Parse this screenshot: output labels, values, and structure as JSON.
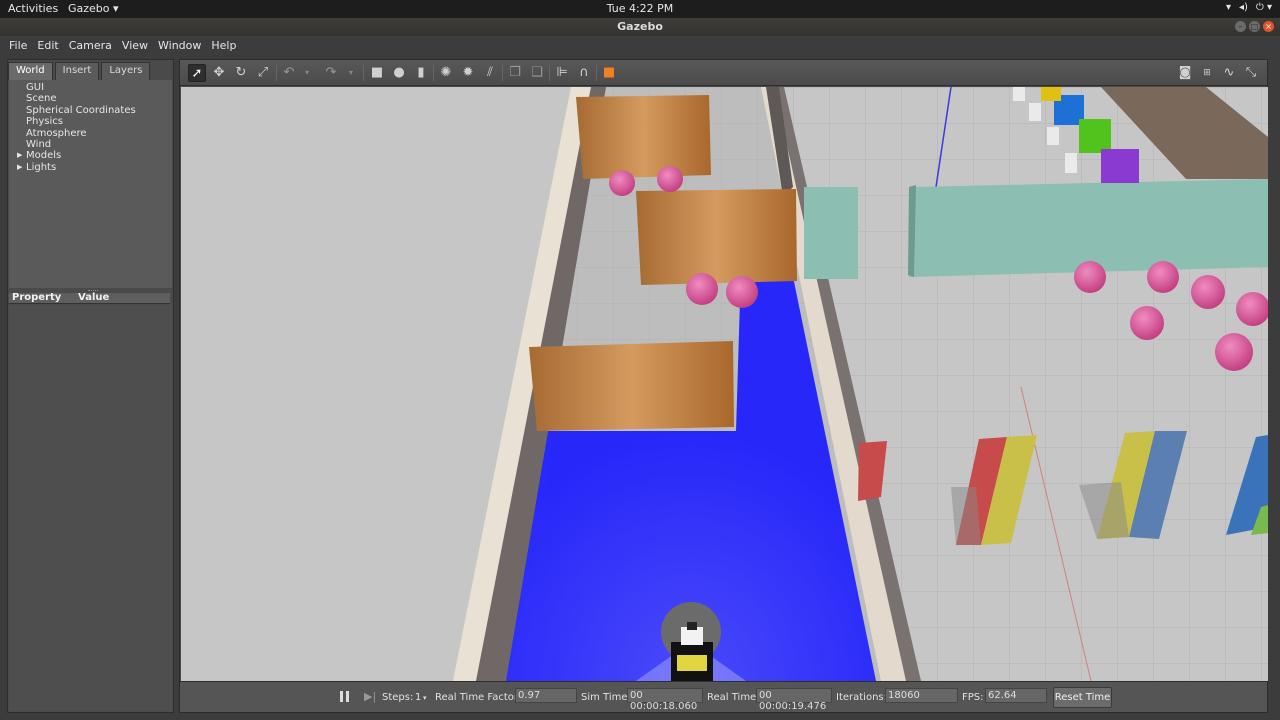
{
  "topbar": {
    "activities": "Activities",
    "app_menu": "Gazebo ▾",
    "clock": "Tue  4:22 PM",
    "tray": [
      "▾",
      "◂)",
      "⏻ ▾"
    ]
  },
  "window": {
    "title": "Gazebo",
    "buttons": [
      "–",
      "□",
      "×"
    ]
  },
  "menu": {
    "items": [
      "File",
      "Edit",
      "Camera",
      "View",
      "Window",
      "Help"
    ]
  },
  "left_panel": {
    "tabs": [
      "World",
      "Insert",
      "Layers"
    ],
    "active_tab": "World",
    "tree": [
      {
        "label": "GUI",
        "expandable": false
      },
      {
        "label": "Scene",
        "expandable": false
      },
      {
        "label": "Spherical Coordinates",
        "expandable": false
      },
      {
        "label": "Physics",
        "expandable": false
      },
      {
        "label": "Atmosphere",
        "expandable": false
      },
      {
        "label": "Wind",
        "expandable": false
      },
      {
        "label": "Models",
        "expandable": true
      },
      {
        "label": "Lights",
        "expandable": true
      }
    ],
    "property_header": "Property",
    "value_header": "Value"
  },
  "toolbar": {
    "icons": [
      "select-arrow-icon",
      "translate-icon",
      "rotate-icon",
      "scale-icon",
      "undo-icon",
      "redo-icon",
      "box-icon",
      "sphere-icon",
      "cylinder-icon",
      "point-light-icon",
      "spot-light-icon",
      "directional-light-icon",
      "copy-icon",
      "paste-icon",
      "align-icon",
      "snap-icon",
      "change-view-icon",
      "screenshot-icon",
      "log-icon",
      "plot-icon",
      "expand-icon"
    ]
  },
  "status": {
    "steps_label": "Steps:",
    "steps_value": "1",
    "rtf_label": "Real Time Factor:",
    "rtf_value": "0.97",
    "sim_time_label": "Sim Time:",
    "sim_time_value": "00 00:00:18.060",
    "real_time_label": "Real Time:",
    "real_time_value": "00 00:00:19.476",
    "iterations_label": "Iterations:",
    "iterations_value": "18060",
    "fps_label": "FPS:",
    "fps_value": "62.64",
    "reset_label": "Reset Time"
  },
  "colors": {
    "laser": "#1a1aff",
    "wall_wood": "#b9783c",
    "ball": "#d9559a",
    "teal_wall": "#8cbfb2"
  }
}
